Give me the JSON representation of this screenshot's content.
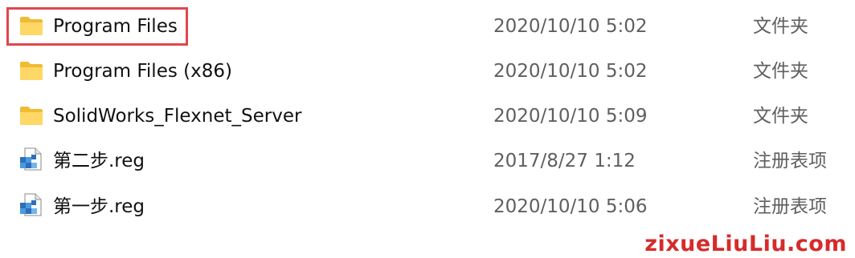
{
  "files": [
    {
      "name": "Program Files",
      "date": "2020/10/10 5:02",
      "type": "文件夹",
      "icon": "folder-icon"
    },
    {
      "name": "Program Files (x86)",
      "date": "2020/10/10 5:02",
      "type": "文件夹",
      "icon": "folder-icon"
    },
    {
      "name": "SolidWorks_Flexnet_Server",
      "date": "2020/10/10 5:09",
      "type": "文件夹",
      "icon": "folder-icon"
    },
    {
      "name": "第二步.reg",
      "date": "2017/8/27 1:12",
      "type": "注册表项",
      "icon": "registry-file-icon"
    },
    {
      "name": "第一步.reg",
      "date": "2020/10/10 5:06",
      "type": "注册表项",
      "icon": "registry-file-icon"
    }
  ],
  "highlight_color": "#e0474c",
  "watermark": "zixueLiuLiu.com"
}
